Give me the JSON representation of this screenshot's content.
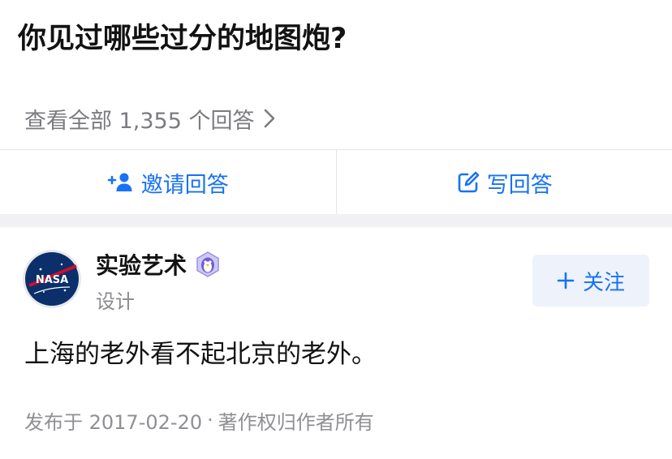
{
  "question": {
    "title": "你见过哪些过分的地图炮?"
  },
  "answers_link": {
    "label": "查看全部 1,355 个回答",
    "icon": "chevron-right-icon"
  },
  "actions": {
    "invite": {
      "label": "邀请回答",
      "icon": "person-add-icon"
    },
    "write": {
      "label": "写回答",
      "icon": "edit-icon"
    }
  },
  "answer": {
    "author": {
      "name": "实验艺术",
      "badge_icon": "penguin-badge-icon",
      "subtitle": "设计",
      "avatar_text": "NASA"
    },
    "follow_button": {
      "label": "关注",
      "icon": "plus-icon"
    },
    "content": "上海的老外看不起北京的老外。",
    "meta": {
      "published": "发布于 2017-02-20",
      "separator": "·",
      "copyright": "著作权归作者所有"
    }
  },
  "colors": {
    "accent": "#1772f6",
    "text": "#121212",
    "muted": "#8a8a8f",
    "band": "#f1f1f3"
  }
}
